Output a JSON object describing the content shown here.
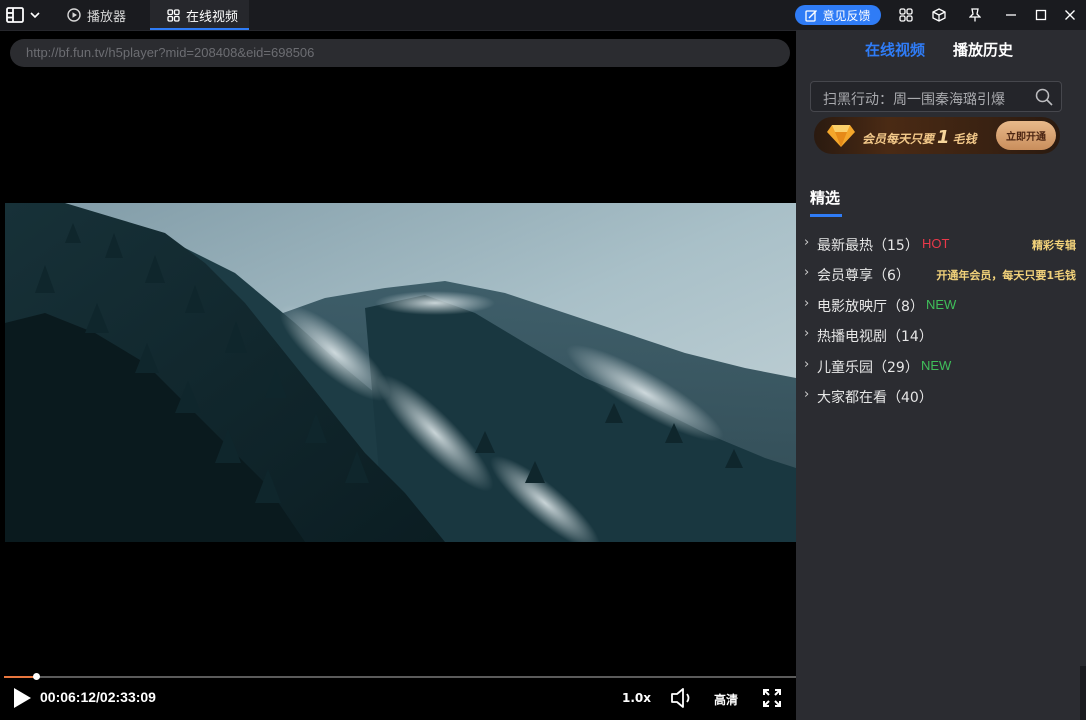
{
  "titlebar": {
    "tabs": [
      {
        "label": "播放器",
        "icon": "play-circle-icon"
      },
      {
        "label": "在线视频",
        "icon": "grid-icon"
      }
    ],
    "feedback_label": "意见反馈"
  },
  "url_bar": {
    "value": "http://bf.fun.tv/h5player?mid=208408&eid=698506"
  },
  "player": {
    "time_current": "00:06:12",
    "time_total": "02:33:09",
    "time_display": "00:06:12/02:33:09",
    "progress_fraction": 0.0405,
    "speed_label": "1.0x",
    "quality_label": "高清"
  },
  "sidebar": {
    "tabs": [
      "在线视频",
      "播放历史"
    ],
    "active_tab": "在线视频",
    "search": {
      "placeholder": "扫黑行动：周一围秦海璐引爆"
    },
    "banner": {
      "text_before": "会员每天只要",
      "number": "1",
      "text_after": "毛钱",
      "button_label": "立即开通"
    },
    "section_title": "精选",
    "categories": [
      {
        "label": "最新最热（15）",
        "badge": "HOT",
        "note": "精彩专辑"
      },
      {
        "label": "会员尊享（6）",
        "badge": "",
        "note": "开通年会员，每天只要1毛钱"
      },
      {
        "label": "电影放映厅（8）",
        "badge": "NEW",
        "note": ""
      },
      {
        "label": "热播电视剧（14）",
        "badge": "",
        "note": ""
      },
      {
        "label": "儿童乐园（29）",
        "badge": "NEW",
        "note": ""
      },
      {
        "label": "大家都在看（40）",
        "badge": "",
        "note": ""
      }
    ]
  },
  "colors": {
    "accent": "#2f7cf6",
    "hot": "#e8394a",
    "new": "#3fbf5a",
    "note": "#f2d27a",
    "progress": "#e9773f"
  }
}
